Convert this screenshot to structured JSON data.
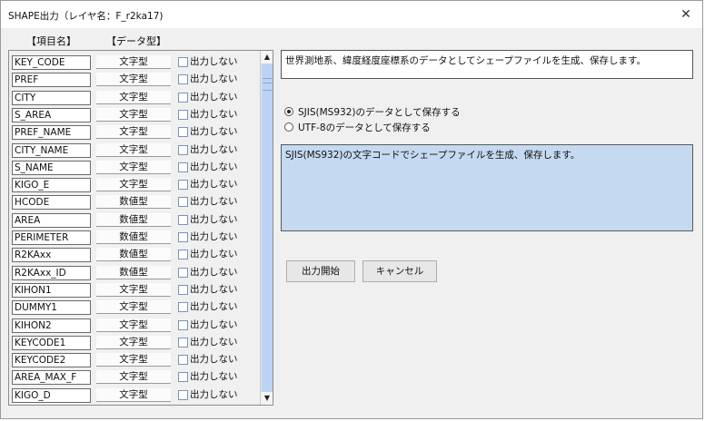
{
  "window": {
    "title": "SHAPE出力（レイヤ名：F_r2ka17)",
    "close_glyph": "✕"
  },
  "headers": {
    "name": "【項目名】",
    "type": "【データ型】"
  },
  "fields": [
    {
      "name": "KEY_CODE",
      "type": "文字型",
      "checkbox_label": "出力しない",
      "checked": false
    },
    {
      "name": "PREF",
      "type": "文字型",
      "checkbox_label": "出力しない",
      "checked": false
    },
    {
      "name": "CITY",
      "type": "文字型",
      "checkbox_label": "出力しない",
      "checked": false
    },
    {
      "name": "S_AREA",
      "type": "文字型",
      "checkbox_label": "出力しない",
      "checked": false
    },
    {
      "name": "PREF_NAME",
      "type": "文字型",
      "checkbox_label": "出力しない",
      "checked": false
    },
    {
      "name": "CITY_NAME",
      "type": "文字型",
      "checkbox_label": "出力しない",
      "checked": false
    },
    {
      "name": "S_NAME",
      "type": "文字型",
      "checkbox_label": "出力しない",
      "checked": false
    },
    {
      "name": "KIGO_E",
      "type": "文字型",
      "checkbox_label": "出力しない",
      "checked": false
    },
    {
      "name": "HCODE",
      "type": "数値型",
      "checkbox_label": "出力しない",
      "checked": false
    },
    {
      "name": "AREA",
      "type": "数値型",
      "checkbox_label": "出力しない",
      "checked": false
    },
    {
      "name": "PERIMETER",
      "type": "数値型",
      "checkbox_label": "出力しない",
      "checked": false
    },
    {
      "name": "R2KAxx",
      "type": "数値型",
      "checkbox_label": "出力しない",
      "checked": false
    },
    {
      "name": "R2KAxx_ID",
      "type": "数値型",
      "checkbox_label": "出力しない",
      "checked": false
    },
    {
      "name": "KIHON1",
      "type": "文字型",
      "checkbox_label": "出力しない",
      "checked": false
    },
    {
      "name": "DUMMY1",
      "type": "文字型",
      "checkbox_label": "出力しない",
      "checked": false
    },
    {
      "name": "KIHON2",
      "type": "文字型",
      "checkbox_label": "出力しない",
      "checked": false
    },
    {
      "name": "KEYCODE1",
      "type": "文字型",
      "checkbox_label": "出力しない",
      "checked": false
    },
    {
      "name": "KEYCODE2",
      "type": "文字型",
      "checkbox_label": "出力しない",
      "checked": false
    },
    {
      "name": "AREA_MAX_F",
      "type": "文字型",
      "checkbox_label": "出力しない",
      "checked": false
    },
    {
      "name": "KIGO_D",
      "type": "文字型",
      "checkbox_label": "出力しない",
      "checked": false
    }
  ],
  "scrollbar": {
    "up_glyph": "▲",
    "down_glyph": "▼"
  },
  "description": "世界測地系、緯度経度座標系のデータとしてシェープファイルを生成、保存します。",
  "encoding": {
    "options": [
      {
        "label": "SJIS(MS932)のデータとして保存する",
        "selected": true
      },
      {
        "label": "UTF-8のデータとして保存する",
        "selected": false
      }
    ],
    "detail": "SJIS(MS932)の文字コードでシェープファイルを生成、保存します。"
  },
  "buttons": {
    "start": "出力開始",
    "cancel": "キャンセル"
  },
  "colors": {
    "detail_background": "#c5d9f1",
    "scroll_thumb": "#bcd3f4"
  }
}
